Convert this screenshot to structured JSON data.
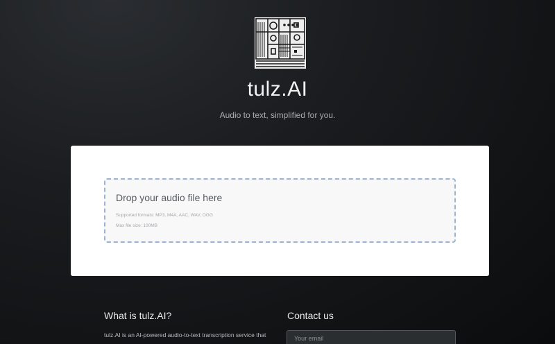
{
  "header": {
    "logo_icon": "abstract-circuit-logo-icon",
    "title": "tulz.AI",
    "tagline": "Audio to text, simplified for you."
  },
  "upload": {
    "drop_label": "Drop your audio file here",
    "formats": "Supported formats: MP3, M4A, AAC, WAV, OGG",
    "max_size": "Max file size: 100MB"
  },
  "about": {
    "heading": "What is tulz.AI?",
    "text": "tulz.AI is an AI-powered audio-to-text transcription service that"
  },
  "contact": {
    "heading": "Contact us",
    "email_placeholder": "Your email"
  },
  "colors": {
    "card_bg": "#ffffff",
    "dropzone_border": "#9ab3d4",
    "page_bg_dark": "#0b0c0d"
  }
}
